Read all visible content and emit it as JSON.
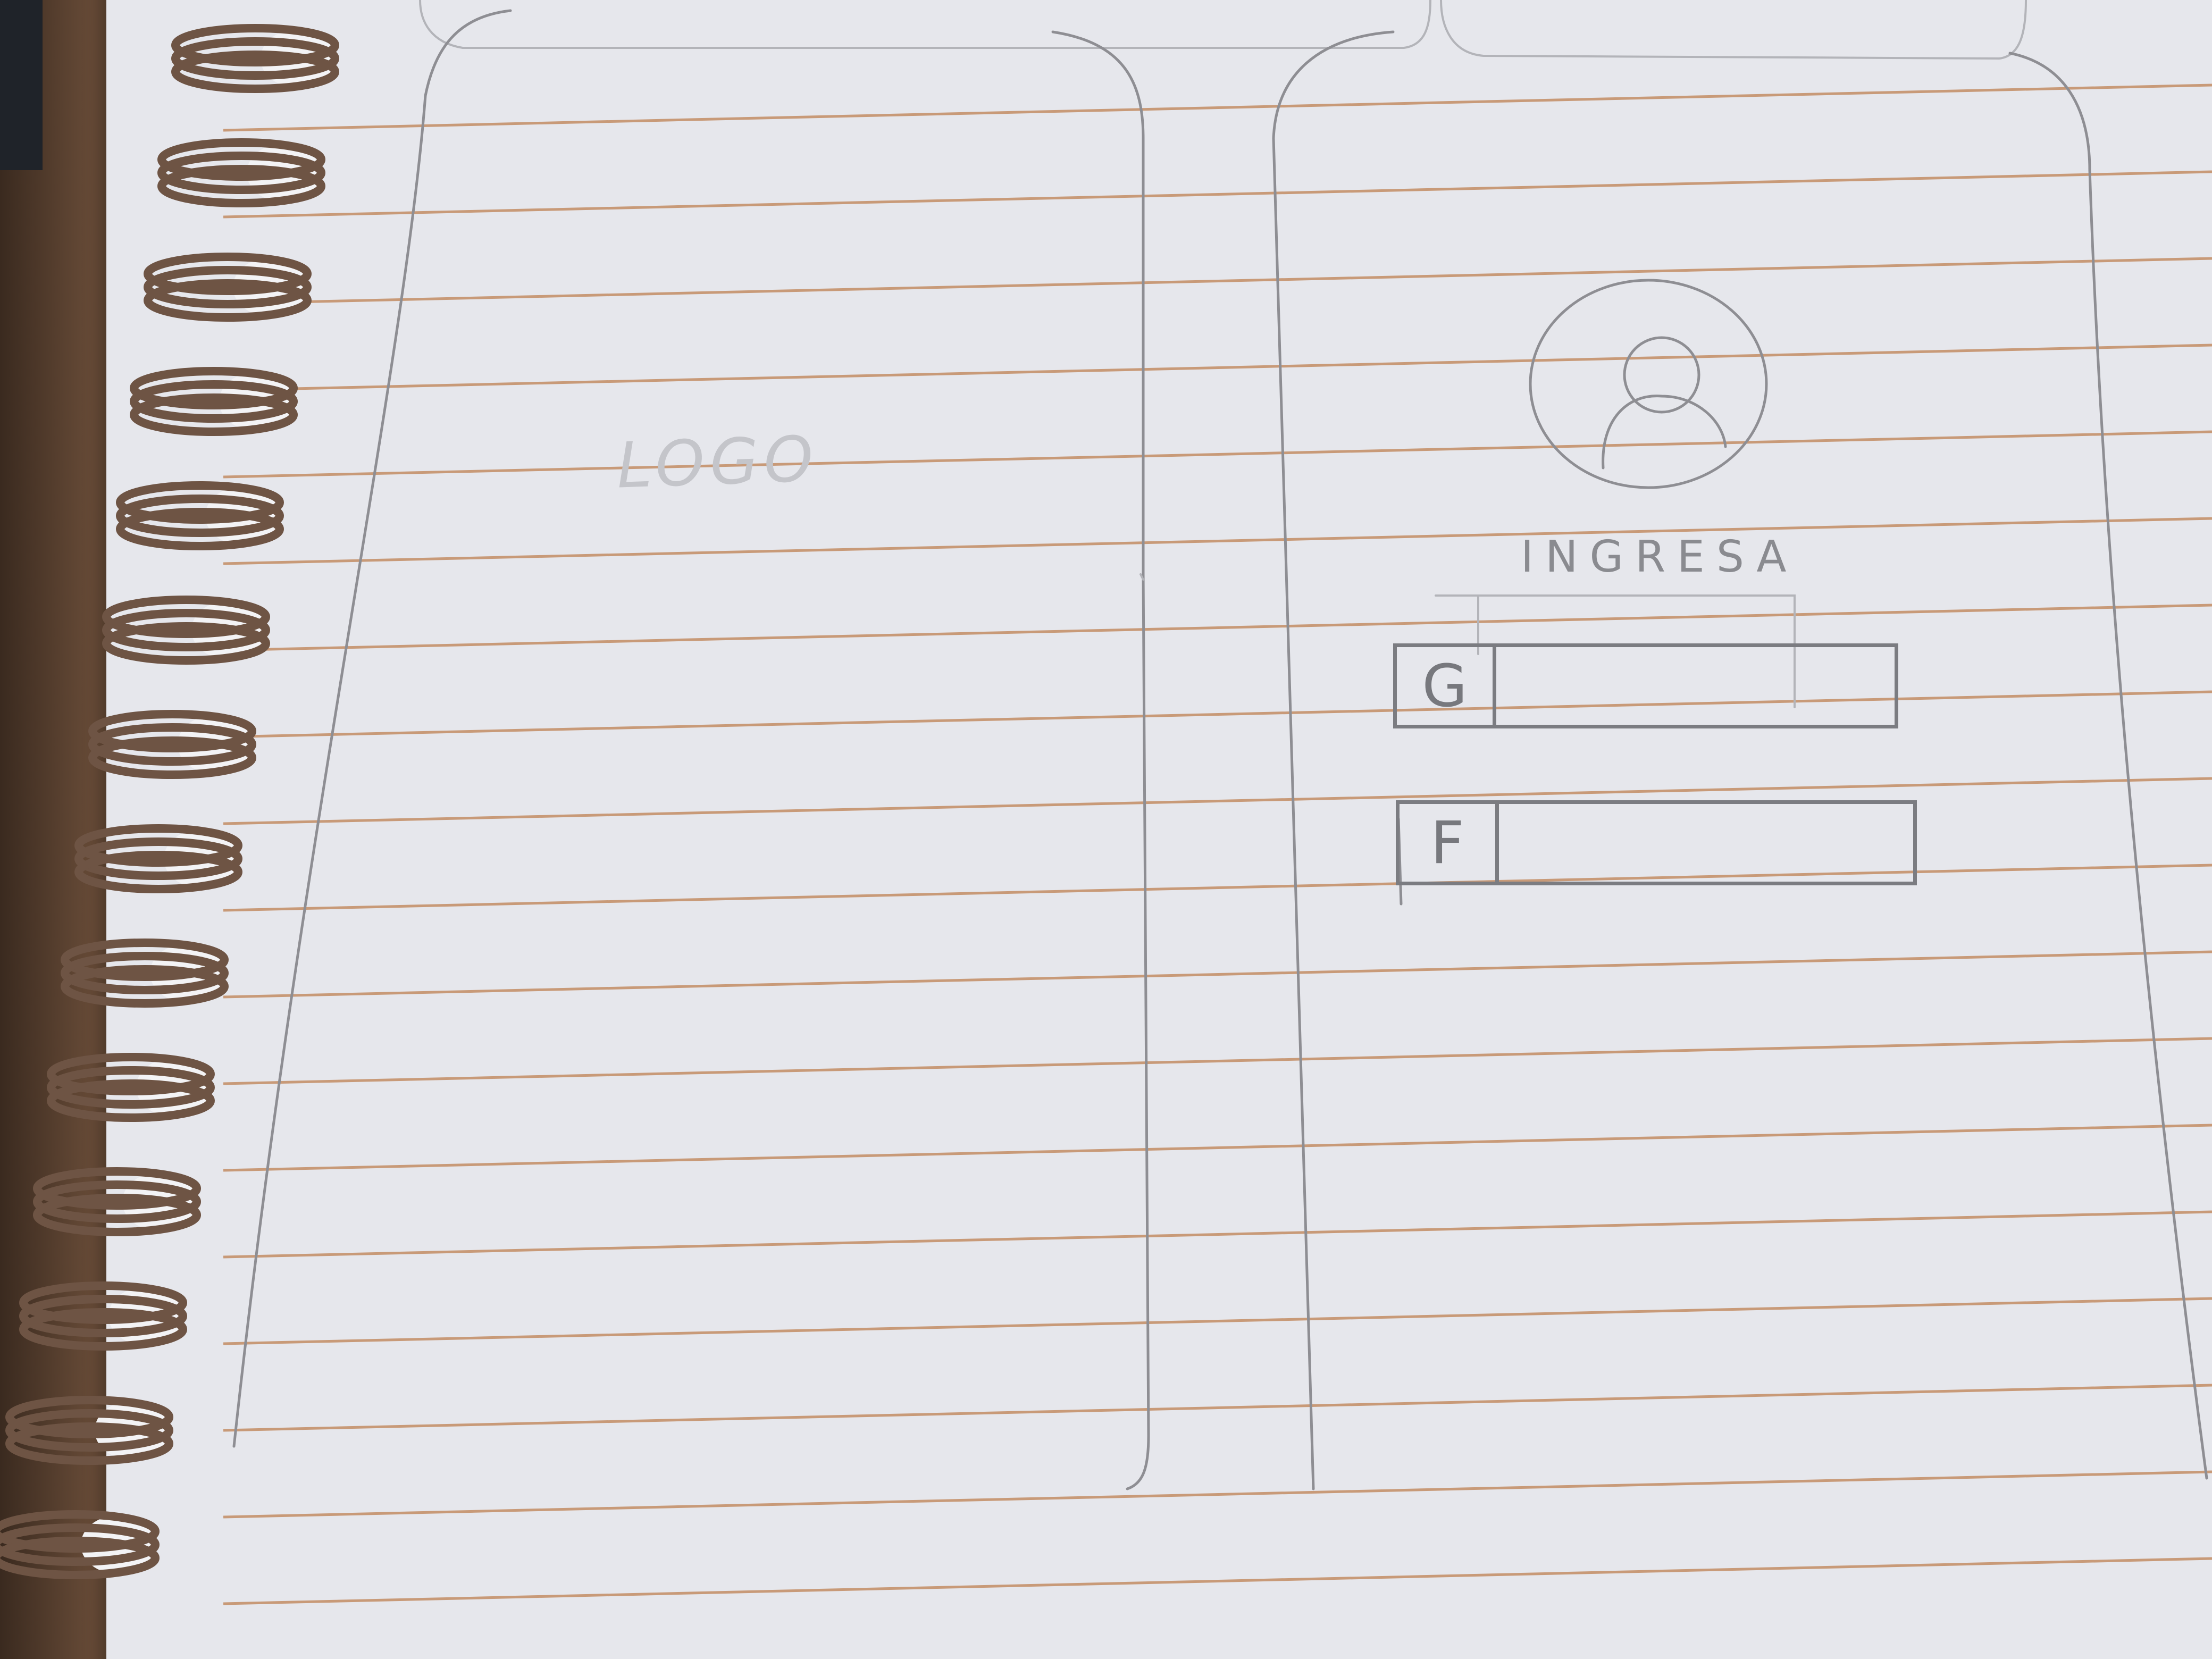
{
  "screen_left": {
    "logo_label": "LOGO"
  },
  "screen_right": {
    "avatar_icon": "user-icon",
    "title": "INGRESA",
    "google_button_letter": "G",
    "facebook_button_letter": "F"
  },
  "colors": {
    "paper": "#e6e7ec",
    "ruling": "#c89a78",
    "pencil": "#8e8e93",
    "spiral": "#6e5444"
  }
}
